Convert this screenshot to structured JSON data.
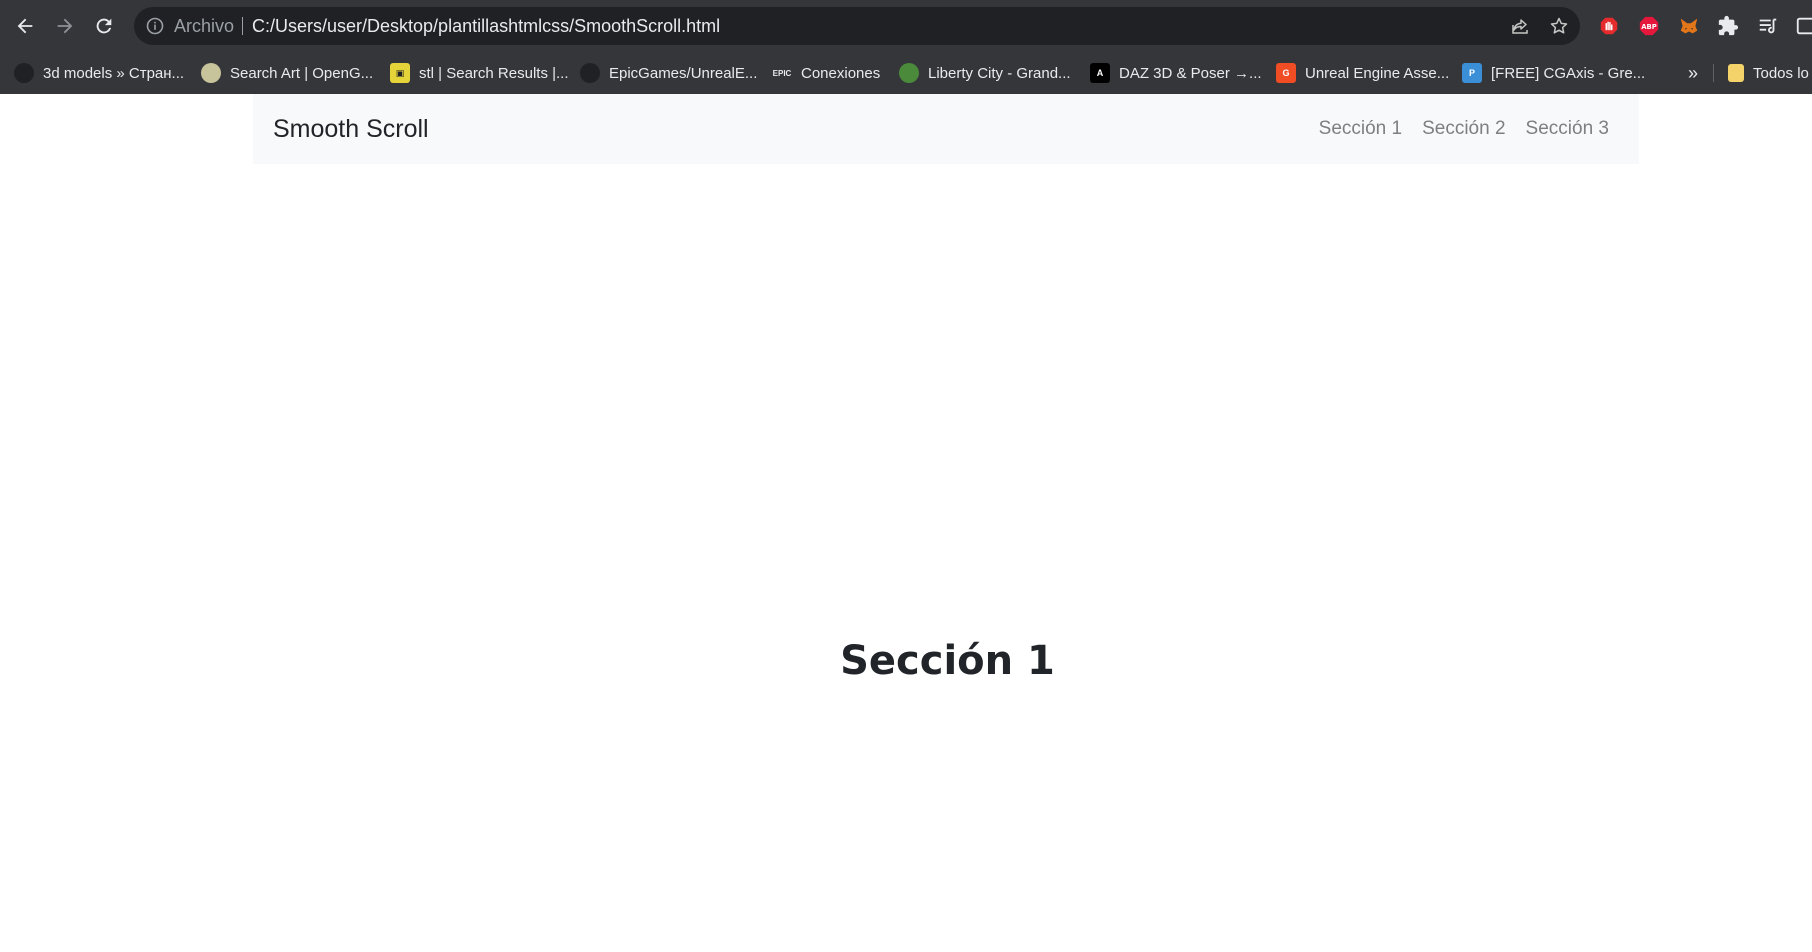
{
  "browser": {
    "address_label": "Archivo",
    "url": "C:/Users/user/Desktop/plantillashtmlcss/SmoothScroll.html",
    "colors": {
      "chrome_bg": "#35363a",
      "omnibox_bg": "#202124"
    },
    "bookmarks": [
      {
        "label": "3d models » Стран...",
        "icon": "globe-icon"
      },
      {
        "label": "Search Art | OpenG...",
        "icon": "opengameart-icon"
      },
      {
        "label": "stl | Search Results |...",
        "icon": "film-icon"
      },
      {
        "label": "EpicGames/UnrealE...",
        "icon": "github-icon"
      },
      {
        "label": "Conexiones",
        "icon": "epic-icon"
      },
      {
        "label": "Liberty City - Grand...",
        "icon": "liberty-icon"
      },
      {
        "label": "DAZ 3D & Poser →...",
        "icon": "daz-icon"
      },
      {
        "label": "Unreal Engine Asse...",
        "icon": "unreal-assets-icon"
      },
      {
        "label": "[FREE] CGAxis - Gre...",
        "icon": "cgaxis-icon"
      }
    ],
    "more_label": "»",
    "folder_label": "Todos lo"
  },
  "page": {
    "brand": "Smooth Scroll",
    "nav": [
      "Sección 1",
      "Sección 2",
      "Sección 3"
    ],
    "section_title": "Sección 1",
    "colors": {
      "navbar_bg": "#f8f9fa",
      "text": "#212529",
      "link": "#7d7f83"
    }
  }
}
